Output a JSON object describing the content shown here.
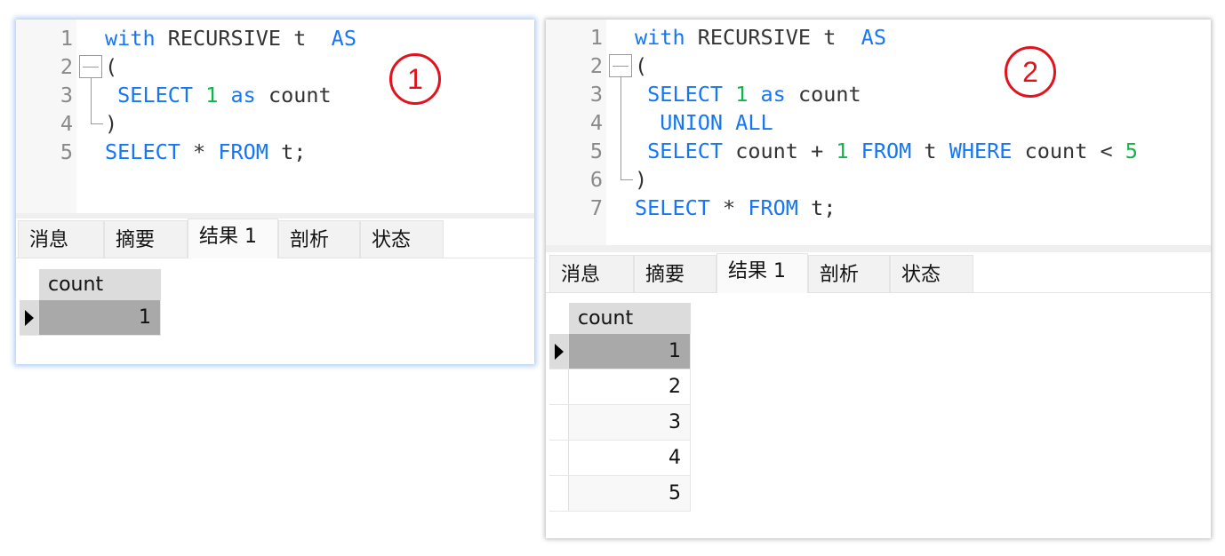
{
  "colors": {
    "keyword": "#1676f3",
    "number": "#12b34a",
    "plain": "#333333",
    "annotation": "#e0141e",
    "selected_row": "#a9a9a9"
  },
  "tabs": [
    "消息",
    "摘要",
    "结果 1",
    "剖析",
    "状态"
  ],
  "active_tab": "结果 1",
  "panels": [
    {
      "annotation": "1",
      "lines": [
        {
          "num": "1",
          "tokens": [
            [
              "with",
              "kw"
            ],
            [
              " RECURSIVE t  ",
              "plain"
            ],
            [
              "AS",
              "kw"
            ]
          ]
        },
        {
          "num": "2",
          "tokens": [
            [
              "(",
              "plain"
            ]
          ]
        },
        {
          "num": "3",
          "tokens": [
            [
              " SELECT ",
              "kw"
            ],
            [
              "1",
              "num"
            ],
            [
              " as ",
              "kw"
            ],
            [
              "count",
              "plain"
            ]
          ]
        },
        {
          "num": "4",
          "tokens": [
            [
              ")",
              "plain"
            ]
          ]
        },
        {
          "num": "5",
          "tokens": [
            [
              "SELECT",
              "kw"
            ],
            [
              " * ",
              "plain"
            ],
            [
              "FROM",
              "kw"
            ],
            [
              " t;",
              "plain"
            ]
          ]
        }
      ],
      "result": {
        "column": "count",
        "rows": [
          "1"
        ],
        "selected_row": 0
      }
    },
    {
      "annotation": "2",
      "lines": [
        {
          "num": "1",
          "tokens": [
            [
              "with",
              "kw"
            ],
            [
              " RECURSIVE t  ",
              "plain"
            ],
            [
              "AS",
              "kw"
            ]
          ]
        },
        {
          "num": "2",
          "tokens": [
            [
              "(",
              "plain"
            ]
          ]
        },
        {
          "num": "3",
          "tokens": [
            [
              " SELECT ",
              "kw"
            ],
            [
              "1",
              "num"
            ],
            [
              " as ",
              "kw"
            ],
            [
              "count",
              "plain"
            ]
          ]
        },
        {
          "num": "4",
          "tokens": [
            [
              "  UNION ALL",
              "kw"
            ]
          ]
        },
        {
          "num": "5",
          "tokens": [
            [
              " SELECT ",
              "kw"
            ],
            [
              "count + ",
              "plain"
            ],
            [
              "1",
              "num"
            ],
            [
              " FROM ",
              "kw"
            ],
            [
              "t ",
              "plain"
            ],
            [
              "WHERE ",
              "kw"
            ],
            [
              "count < ",
              "plain"
            ],
            [
              "5",
              "num"
            ]
          ]
        },
        {
          "num": "6",
          "tokens": [
            [
              ")",
              "plain"
            ]
          ]
        },
        {
          "num": "7",
          "tokens": [
            [
              "SELECT",
              "kw"
            ],
            [
              " * ",
              "plain"
            ],
            [
              "FROM",
              "kw"
            ],
            [
              " t;",
              "plain"
            ]
          ]
        }
      ],
      "result": {
        "column": "count",
        "rows": [
          "1",
          "2",
          "3",
          "4",
          "5"
        ],
        "selected_row": 0
      }
    }
  ]
}
